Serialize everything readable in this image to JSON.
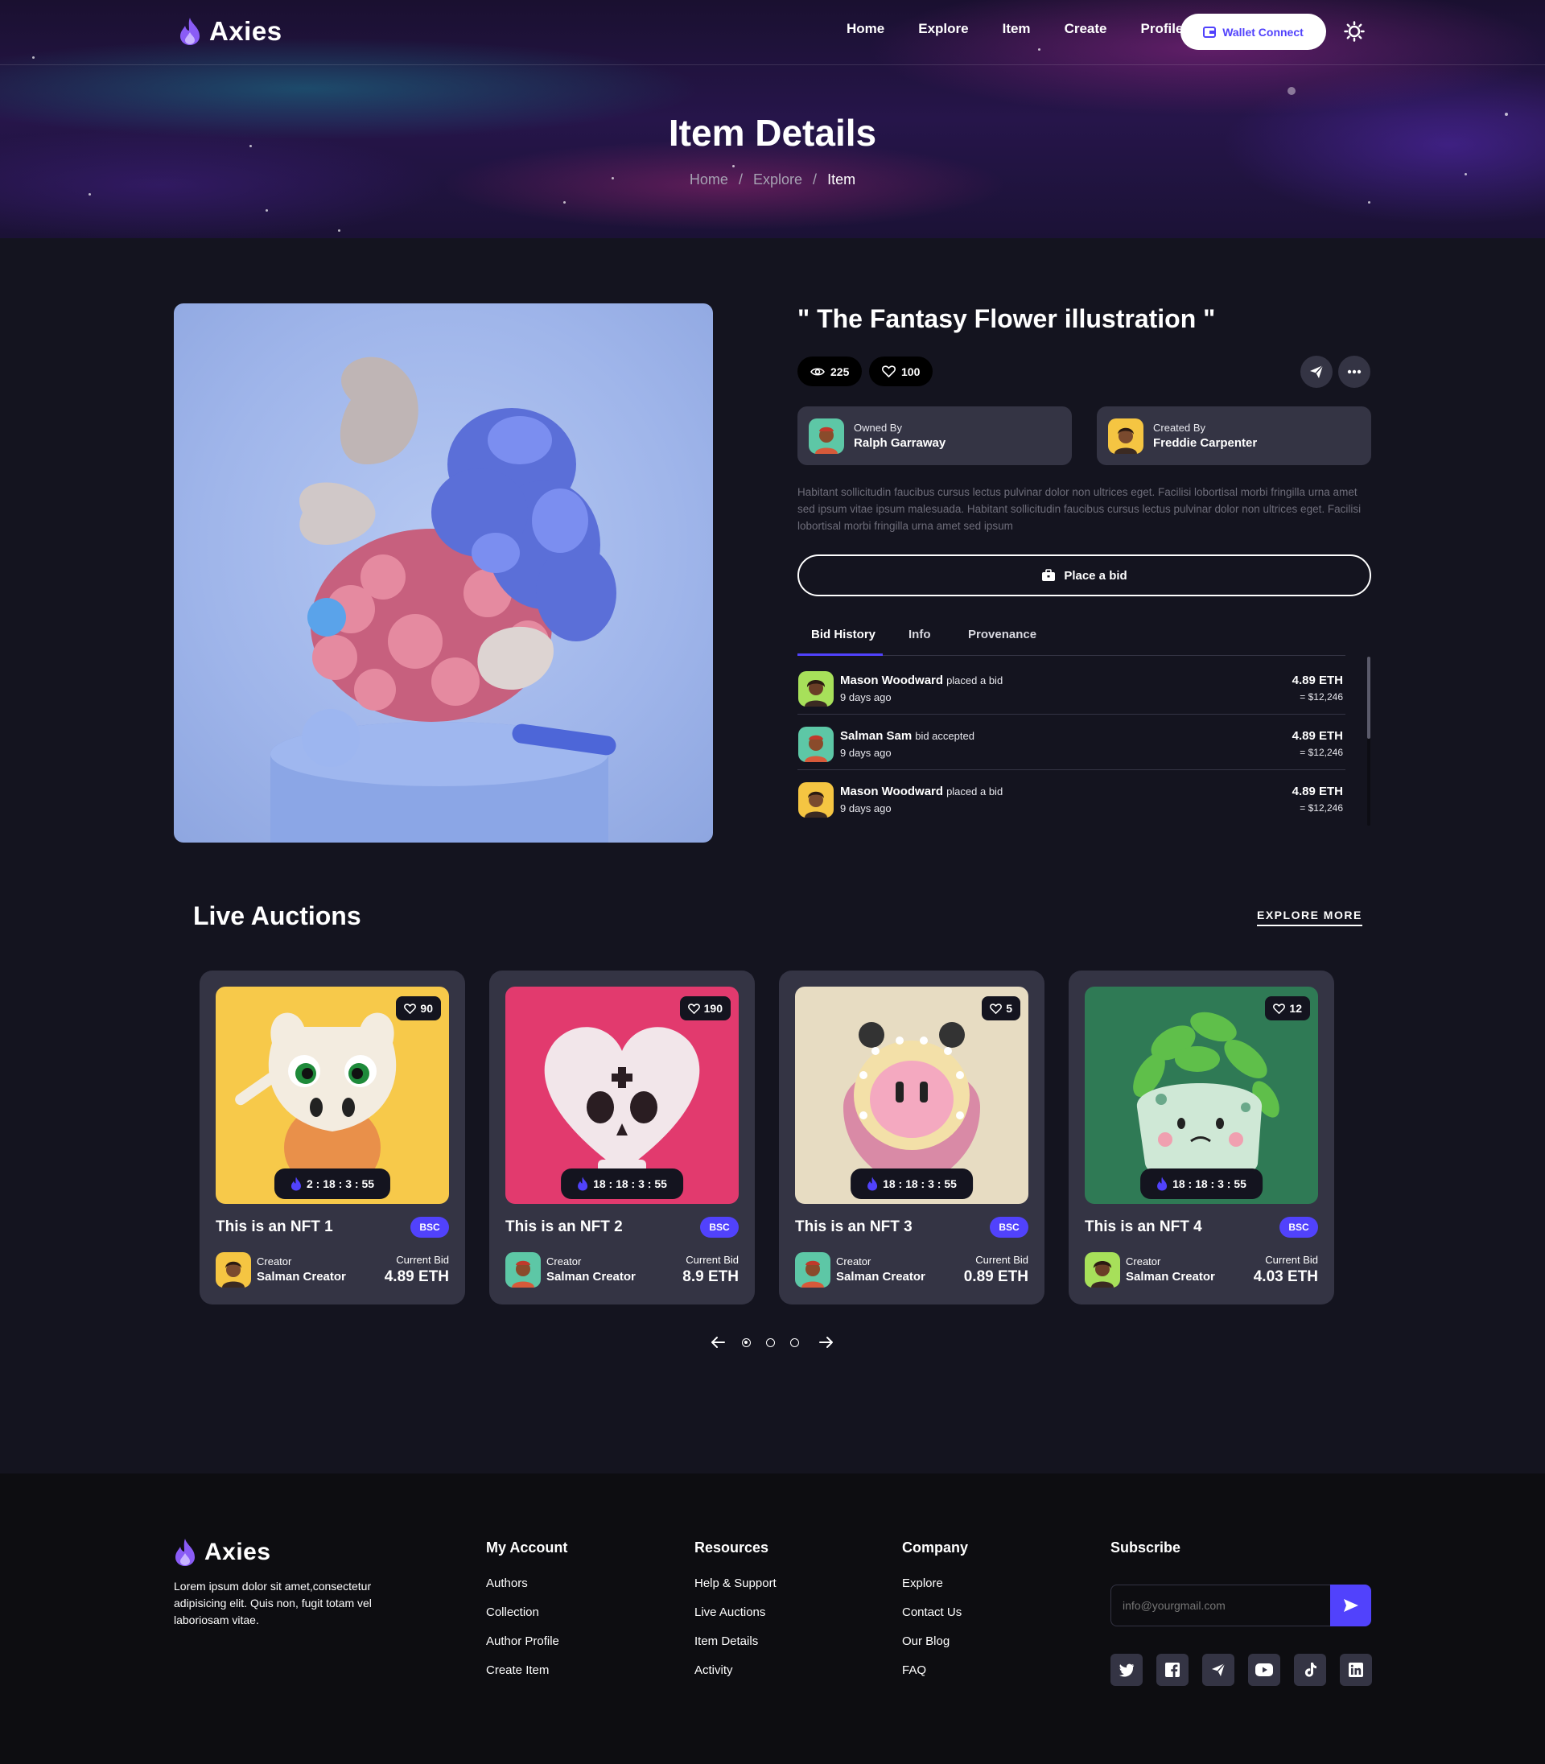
{
  "brand": {
    "name": "Axies",
    "accent": "#5142fc",
    "flame_color": "#8a5cf6"
  },
  "nav": {
    "items": [
      "Home",
      "Explore",
      "Item",
      "Create",
      "Profile"
    ],
    "wallet_label": "Wallet Connect",
    "theme_icon": "sun-icon"
  },
  "hero": {
    "title": "Item Details",
    "breadcrumb": [
      "Home",
      "Explore",
      "Item"
    ],
    "separator": "/"
  },
  "item": {
    "title": "\" The Fantasy Flower illustration \"",
    "views": "225",
    "likes": "100",
    "owner_label": "Owned By",
    "owner_name": "Ralph Garraway",
    "creator_label": "Created By",
    "creator_name": "Freddie Carpenter",
    "description": "Habitant sollicitudin faucibus cursus lectus pulvinar dolor non ultrices eget. Facilisi lobortisal morbi fringilla urna amet sed ipsum vitae ipsum malesuada. Habitant sollicitudin faucibus cursus lectus pulvinar dolor non ultrices eget. Facilisi lobortisal morbi fringilla urna amet sed ipsum",
    "bid_button": "Place a bid"
  },
  "tabs": [
    "Bid History",
    "Info",
    "Provenance"
  ],
  "bids": [
    {
      "name": "Mason Woodward",
      "action": "placed a bid",
      "time": "9 days ago",
      "eth": "4.89 ETH",
      "usd": "= $12,246",
      "avatar_bg": "#a7e05a"
    },
    {
      "name": "Salman Sam",
      "action": "bid accepted",
      "time": "9 days ago",
      "eth": "4.89 ETH",
      "usd": "= $12,246",
      "avatar_bg": "#5dc7a6"
    },
    {
      "name": "Mason Woodward",
      "action": "placed a bid",
      "time": "9 days ago",
      "eth": "4.89 ETH",
      "usd": "= $12,246",
      "avatar_bg": "#f5c542"
    }
  ],
  "auctions": {
    "title": "Live Auctions",
    "explore_label": "EXPLORE MORE",
    "cards": [
      {
        "title": "This is an NFT 1",
        "likes": "90",
        "timer": "2 : 18 : 3 : 55",
        "chain": "BSC",
        "creator_label": "Creator",
        "creator": "Salman Creator",
        "bid_label": "Current Bid",
        "bid": "4.89 ETH",
        "bg": "#f7c94a",
        "avatar_bg": "#f5c542"
      },
      {
        "title": "This is an NFT 2",
        "likes": "190",
        "timer": "18 : 18 : 3 : 55",
        "chain": "BSC",
        "creator_label": "Creator",
        "creator": "Salman Creator",
        "bid_label": "Current Bid",
        "bid": "8.9 ETH",
        "bg": "#e23a6e",
        "avatar_bg": "#5dc7a6"
      },
      {
        "title": "This is an NFT 3",
        "likes": "5",
        "timer": "18 : 18 : 3 : 55",
        "chain": "BSC",
        "creator_label": "Creator",
        "creator": "Salman Creator",
        "bid_label": "Current Bid",
        "bid": "0.89 ETH",
        "bg": "#e7dcc2",
        "avatar_bg": "#5dc7a6"
      },
      {
        "title": "This is an NFT 4",
        "likes": "12",
        "timer": "18 : 18 : 3 : 55",
        "chain": "BSC",
        "creator_label": "Creator",
        "creator": "Salman Creator",
        "bid_label": "Current Bid",
        "bid": "4.03 ETH",
        "bg": "#2f7a55",
        "avatar_bg": "#a7e05a"
      }
    ]
  },
  "footer": {
    "about": "Lorem ipsum dolor sit amet,consectetur adipisicing elit. Quis non, fugit totam vel laboriosam vitae.",
    "columns": [
      {
        "title": "My Account",
        "links": [
          "Authors",
          "Collection",
          "Author Profile",
          "Create Item"
        ]
      },
      {
        "title": "Resources",
        "links": [
          "Help & Support",
          "Live Auctions",
          "Item Details",
          "Activity"
        ]
      },
      {
        "title": "Company",
        "links": [
          "Explore",
          "Contact Us",
          "Our Blog",
          "FAQ"
        ]
      }
    ],
    "subscribe_title": "Subscribe",
    "subscribe_placeholder": "info@yourgmail.com",
    "socials": [
      "twitter-icon",
      "facebook-icon",
      "telegram-icon",
      "youtube-icon",
      "tiktok-icon",
      "linkedin-icon"
    ]
  }
}
